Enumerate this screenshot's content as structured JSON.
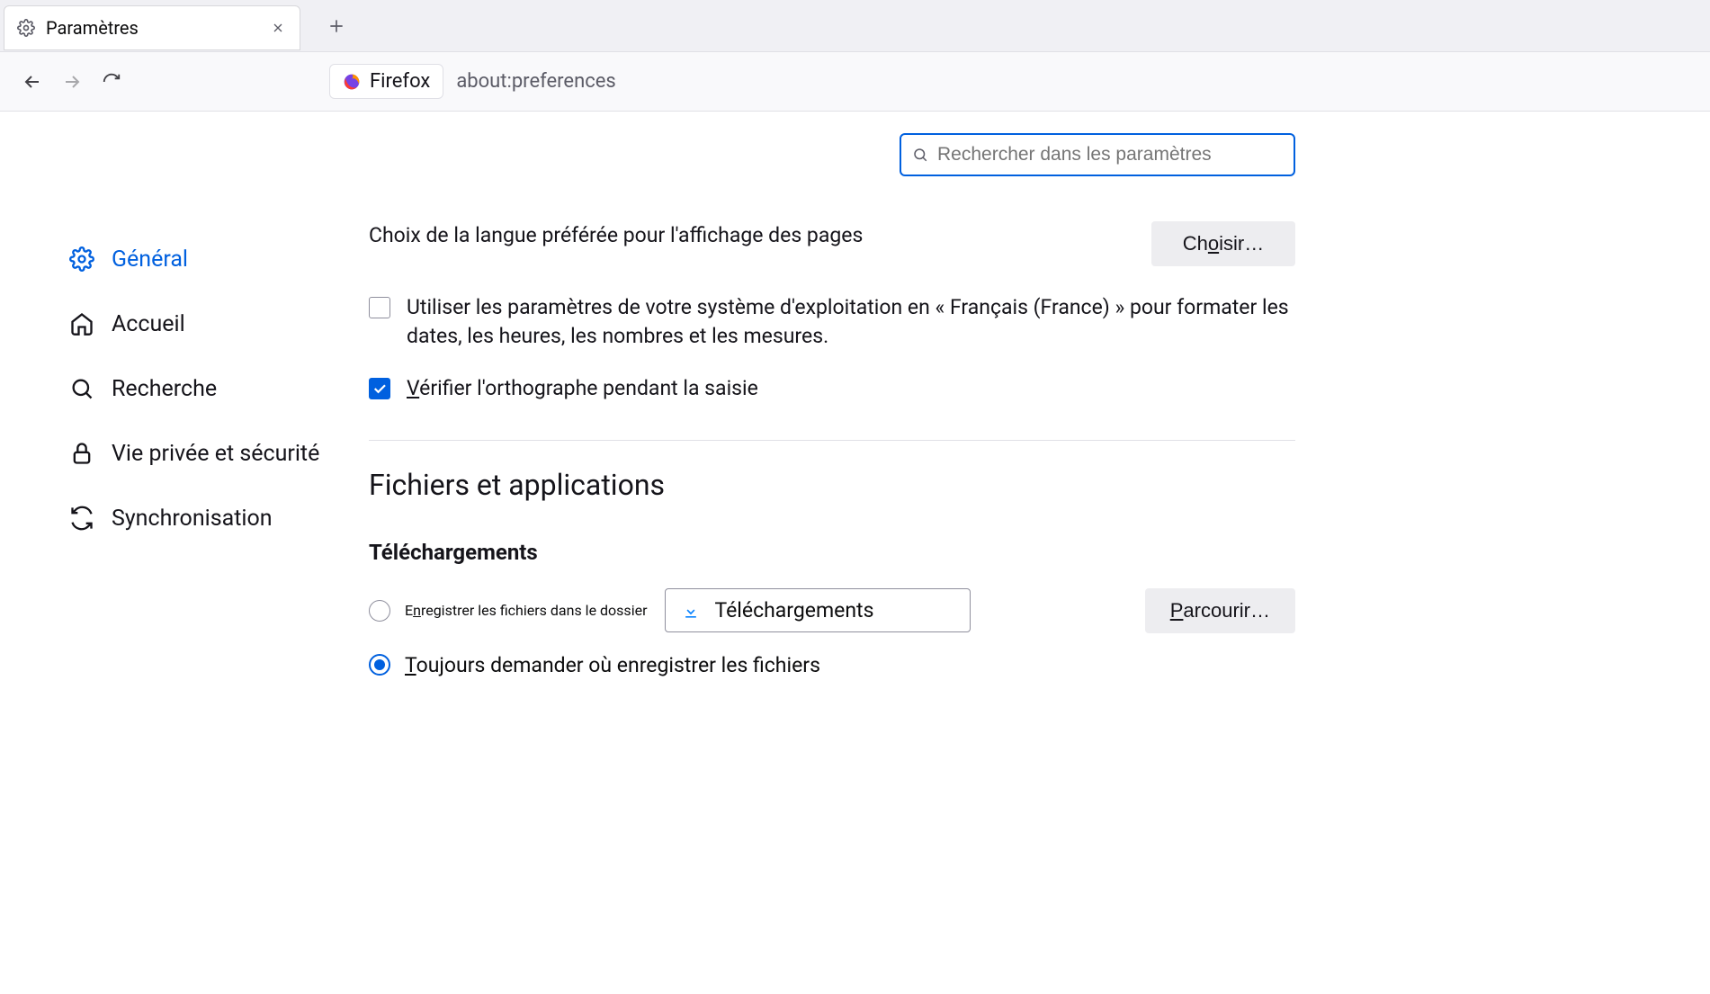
{
  "tab": {
    "title": "Paramètres"
  },
  "address": {
    "identity": "Firefox",
    "url": "about:preferences"
  },
  "search": {
    "placeholder": "Rechercher dans les paramètres"
  },
  "sidebar": {
    "items": [
      {
        "label": "Général",
        "active": true
      },
      {
        "label": "Accueil"
      },
      {
        "label": "Recherche"
      },
      {
        "label": "Vie privée et sécurité"
      },
      {
        "label": "Synchronisation"
      }
    ]
  },
  "language": {
    "desc": "Choix de la langue préférée pour l'affichage des pages",
    "choose_btn_pre": "Ch",
    "choose_btn_u": "o",
    "choose_btn_post": "isir…",
    "use_os_locale": "Utiliser les paramètres de votre système d'exploitation en « Français (France) » pour formater les dates, les heures, les nombres et les mesures.",
    "spellcheck_u": "V",
    "spellcheck_post": "érifier l'orthographe pendant la saisie"
  },
  "files": {
    "section_title": "Fichiers et applications",
    "downloads_title": "Téléchargements",
    "save_to_pre": "E",
    "save_to_u": "n",
    "save_to_post": "registrer les fichiers dans le dossier",
    "folder_label": "Téléchargements",
    "browse_btn_u": "P",
    "browse_btn_post": "arcourir…",
    "always_ask_u": "T",
    "always_ask_post": "oujours demander où enregistrer les fichiers"
  }
}
